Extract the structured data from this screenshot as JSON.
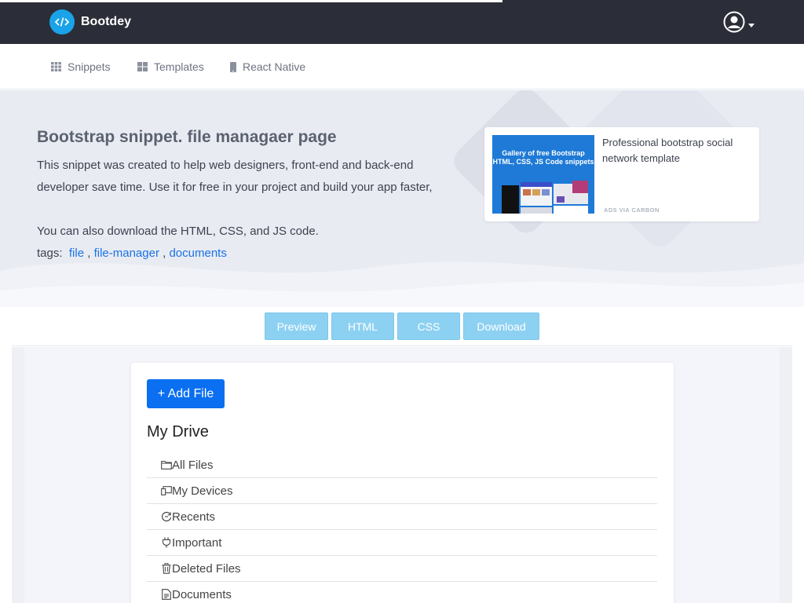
{
  "topbar": {
    "brand": "Bootdey"
  },
  "subnav": {
    "items": [
      {
        "label": "Snippets",
        "icon": "grid-icon"
      },
      {
        "label": "Templates",
        "icon": "layout-icon"
      },
      {
        "label": "React Native",
        "icon": "phone-icon"
      }
    ]
  },
  "hero": {
    "title": "Bootstrap snippet. file managaer page",
    "description": "This snippet was created to help web designers, front-end and back-end developer save time. Use it for free in your project and build your app faster,",
    "download_note": "You can also download the HTML, CSS, and JS code.",
    "tags_label": "tags:",
    "tags": [
      "file",
      "file-manager",
      "documents"
    ],
    "tag_separator": ","
  },
  "ad": {
    "image_text": "Gallery of free Bootstrap HTML, CSS, JS Code snippets",
    "text": "Professional bootstrap social network template",
    "via": "ADS VIA CARBON"
  },
  "code_tabs": [
    "Preview",
    "HTML",
    "CSS",
    "Download"
  ],
  "file_manager": {
    "add_button": "+ Add File",
    "title": "My Drive",
    "items": [
      {
        "label": "All Files",
        "icon": "folder-icon"
      },
      {
        "label": "My Devices",
        "icon": "devices-icon"
      },
      {
        "label": "Recents",
        "icon": "recent-icon"
      },
      {
        "label": "Important",
        "icon": "plug-icon"
      },
      {
        "label": "Deleted Files",
        "icon": "trash-icon"
      },
      {
        "label": "Documents",
        "icon": "document-icon"
      }
    ]
  },
  "colors": {
    "topbar": "#2b2d38",
    "brand_logo": "#1aa3e8",
    "tab_button": "#8dd1f2",
    "primary_button": "#0a6ff0",
    "link": "#1a73e8"
  }
}
